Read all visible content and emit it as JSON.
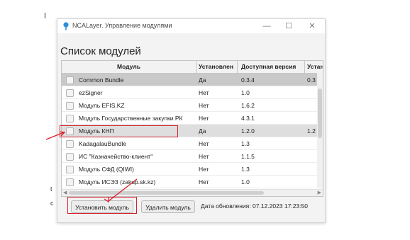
{
  "window": {
    "title": "NCALayer. Управление модулями",
    "controls": {
      "minimize": "—",
      "maximize": "☐",
      "close": "✕"
    }
  },
  "heading": "Список модулей",
  "table": {
    "columns": [
      "Модуль",
      "Установлен",
      "Доступная версия",
      "Устан"
    ],
    "rows": [
      {
        "name": "Common Bundle",
        "installed": "Да",
        "available": "0.3.4",
        "inst_ver": "0.3",
        "highlight": "gray"
      },
      {
        "name": "ezSigner",
        "installed": "Нет",
        "available": "1.0",
        "inst_ver": "",
        "highlight": ""
      },
      {
        "name": "Модуль EFIS.KZ",
        "installed": "Нет",
        "available": "1.6.2",
        "inst_ver": "",
        "highlight": ""
      },
      {
        "name": "Модуль Государственные закупки РК",
        "installed": "Нет",
        "available": "4.3.1",
        "inst_ver": "",
        "highlight": ""
      },
      {
        "name": "Модуль КНП",
        "installed": "Да",
        "available": "1.2.0",
        "inst_ver": "1.2",
        "highlight": "lightgray"
      },
      {
        "name": "KadagalauBundle",
        "installed": "Нет",
        "available": "1.3",
        "inst_ver": "",
        "highlight": ""
      },
      {
        "name": "ИС \"Казначейство-клиент\"",
        "installed": "Нет",
        "available": "1.1.5",
        "inst_ver": "",
        "highlight": ""
      },
      {
        "name": "Модуль СФД (QIWI)",
        "installed": "Нет",
        "available": "1.3",
        "inst_ver": "",
        "highlight": ""
      },
      {
        "name": "Модуль ИСЭЗ (zakup.sk.kz)",
        "installed": "Нет",
        "available": "1.0",
        "inst_ver": "",
        "highlight": ""
      }
    ]
  },
  "buttons": {
    "install": "Установить модуль",
    "remove": "Удалить модуль"
  },
  "update_date": "Дата обновления: 07.12.2023 17:23:50",
  "stray_text": [
    "I",
    "t",
    "c"
  ],
  "colors": {
    "annotation": "#d8202a",
    "selected_row": "#c9c9c9",
    "hover_row": "#dedede"
  },
  "icons": {
    "app": "ncalayer-pin-icon"
  }
}
